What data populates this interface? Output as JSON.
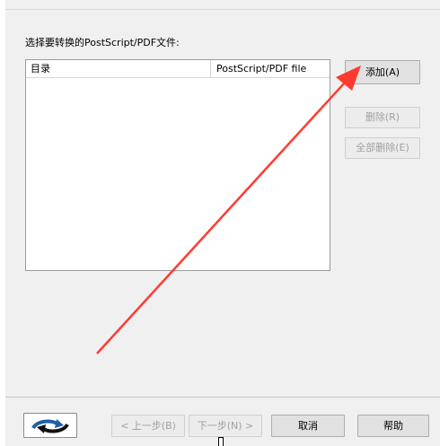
{
  "instruction": "选择要转换的PostScript/PDF文件:",
  "file_list": {
    "columns": [
      "目录",
      "PostScript/PDF file"
    ],
    "rows": []
  },
  "buttons": {
    "add": "添加(A)",
    "delete": "删除(R)",
    "delete_all": "全部删除(E)"
  },
  "wizard_nav": {
    "back": "< 上一步(B)",
    "next": "下一步(N) >",
    "cancel": "取消",
    "help": "帮助"
  },
  "annotation": {
    "color": "#ff3b30"
  },
  "logo": {
    "icon": "refresh-arrows-icon",
    "colors": [
      "#1f5fa8",
      "#000000"
    ]
  }
}
